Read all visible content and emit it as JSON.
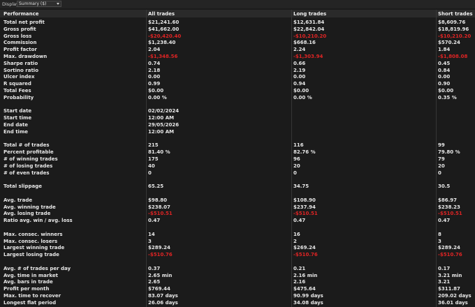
{
  "toolbar": {
    "display_label": "Display",
    "display_value": "Summary ($)"
  },
  "table": {
    "columns": [
      "Performance",
      "All trades",
      "Long trades",
      "Short trades"
    ],
    "negative_color": "#e02424",
    "rows": [
      {
        "label": "Total net profit",
        "all": "$21,241.60",
        "long": "$12,631.84",
        "short": "$8,609.76"
      },
      {
        "label": "Gross profit",
        "all": "$41,662.00",
        "long": "$22,842.04",
        "short": "$18,819.96"
      },
      {
        "label": "Gross loss",
        "all": "-$20,420.40",
        "long": "-$10,210.20",
        "short": "-$10,210.20",
        "neg": true
      },
      {
        "label": "Commission",
        "all": "$1,238.40",
        "long": "$668.16",
        "short": "$570.24"
      },
      {
        "label": "Profit factor",
        "all": "2.04",
        "long": "2.24",
        "short": "1.84"
      },
      {
        "label": "Max. drawdown",
        "all": "-$1,348.56",
        "long": "-$1,303.94",
        "short": "-$1,808.08",
        "neg": true
      },
      {
        "label": "Sharpe ratio",
        "all": "0.74",
        "long": "0.66",
        "short": "0.45"
      },
      {
        "label": "Sortino ratio",
        "all": "2.18",
        "long": "2.19",
        "short": "0.84"
      },
      {
        "label": "Ulcer index",
        "all": "0.00",
        "long": "0.00",
        "short": "0.00"
      },
      {
        "label": "R squared",
        "all": "0.99",
        "long": "0.94",
        "short": "0.90"
      },
      {
        "label": "Total Fees",
        "all": "$0.00",
        "long": "$0.00",
        "short": "$0.00"
      },
      {
        "label": "Probability",
        "all": "0.00 %",
        "long": "0.00 %",
        "short": "0.35 %"
      },
      {
        "label": "",
        "all": "",
        "long": "",
        "short": ""
      },
      {
        "label": "Start date",
        "all": "02/02/2024",
        "long": "",
        "short": ""
      },
      {
        "label": "Start time",
        "all": "12:00 AM",
        "long": "",
        "short": ""
      },
      {
        "label": "End date",
        "all": "29/05/2026",
        "long": "",
        "short": ""
      },
      {
        "label": "End time",
        "all": "12:00 AM",
        "long": "",
        "short": ""
      },
      {
        "label": "",
        "all": "",
        "long": "",
        "short": ""
      },
      {
        "label": "Total # of trades",
        "all": "215",
        "long": "116",
        "short": "99"
      },
      {
        "label": "Percent profitable",
        "all": "81.40 %",
        "long": "82.76 %",
        "short": "79.80 %"
      },
      {
        "label": "# of winning trades",
        "all": "175",
        "long": "96",
        "short": "79"
      },
      {
        "label": "# of losing trades",
        "all": "40",
        "long": "20",
        "short": "20"
      },
      {
        "label": "# of even trades",
        "all": "0",
        "long": "0",
        "short": "0"
      },
      {
        "label": "",
        "all": "",
        "long": "",
        "short": ""
      },
      {
        "label": "Total slippage",
        "all": "65.25",
        "long": "34.75",
        "short": "30.5"
      },
      {
        "label": "",
        "all": "",
        "long": "",
        "short": ""
      },
      {
        "label": "Avg. trade",
        "all": "$98.80",
        "long": "$108.90",
        "short": "$86.97"
      },
      {
        "label": "Avg. winning trade",
        "all": "$238.07",
        "long": "$237.94",
        "short": "$238.23"
      },
      {
        "label": "Avg. losing trade",
        "all": "-$510.51",
        "long": "-$510.51",
        "short": "-$510.51",
        "neg": true
      },
      {
        "label": "Ratio avg. win / avg. loss",
        "all": "0.47",
        "long": "0.47",
        "short": "0.47"
      },
      {
        "label": "",
        "all": "",
        "long": "",
        "short": ""
      },
      {
        "label": "Max. consec. winners",
        "all": "14",
        "long": "16",
        "short": "8"
      },
      {
        "label": "Max. consec. losers",
        "all": "3",
        "long": "2",
        "short": "3"
      },
      {
        "label": "Largest winning trade",
        "all": "$289.24",
        "long": "$269.24",
        "short": "$289.24"
      },
      {
        "label": "Largest losing trade",
        "all": "-$510.76",
        "long": "-$510.76",
        "short": "-$510.76",
        "neg": true
      },
      {
        "label": "",
        "all": "",
        "long": "",
        "short": ""
      },
      {
        "label": "Avg. # of trades per day",
        "all": "0.37",
        "long": "0.21",
        "short": "0.17"
      },
      {
        "label": "Avg. time in market",
        "all": "2.65 min",
        "long": "2.16 min",
        "short": "3.21 min"
      },
      {
        "label": "Avg. bars in trade",
        "all": "2.65",
        "long": "2.16",
        "short": "3.21"
      },
      {
        "label": "Profit per month",
        "all": "$769.44",
        "long": "$475.64",
        "short": "$311.87"
      },
      {
        "label": "Max. time to recover",
        "all": "83.07 days",
        "long": "90.99 days",
        "short": "209.02 days"
      },
      {
        "label": "Longest flat period",
        "all": "26.06 days",
        "long": "34.08 days",
        "short": "36.01 days"
      }
    ]
  }
}
